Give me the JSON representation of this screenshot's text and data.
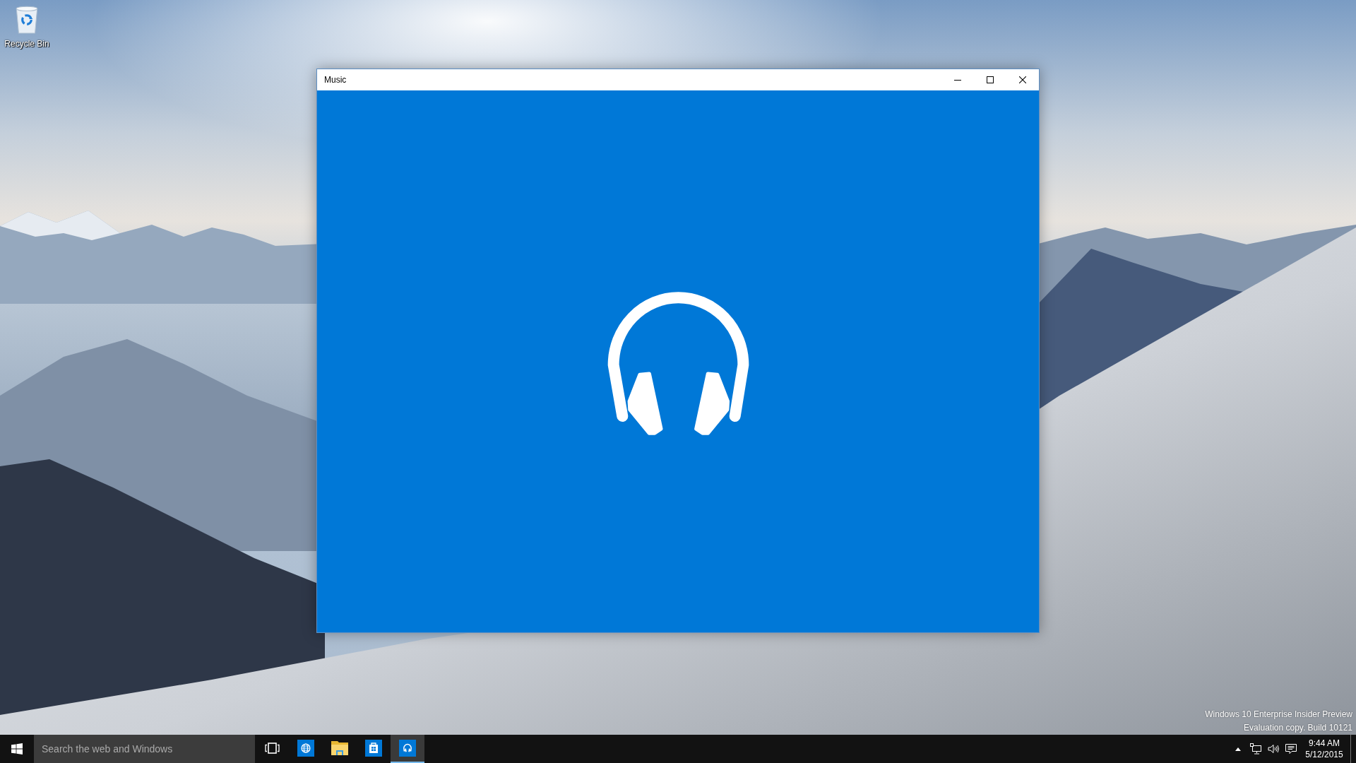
{
  "desktop": {
    "icons": [
      {
        "label": "Recycle Bin"
      }
    ],
    "notice_lines": [
      "Windows 10 Enterprise Insider Preview",
      "Evaluation copy. Build 10121"
    ]
  },
  "window": {
    "title": "Music"
  },
  "taskbar": {
    "search": {
      "placeholder": "Search the web and Windows"
    },
    "apps": [
      {
        "kind": "browser",
        "selected": false
      },
      {
        "kind": "explorer",
        "selected": false
      },
      {
        "kind": "store",
        "selected": false
      },
      {
        "kind": "music",
        "selected": true
      }
    ],
    "clock": {
      "time": "9:44 AM",
      "date": "5/12/2015"
    }
  }
}
